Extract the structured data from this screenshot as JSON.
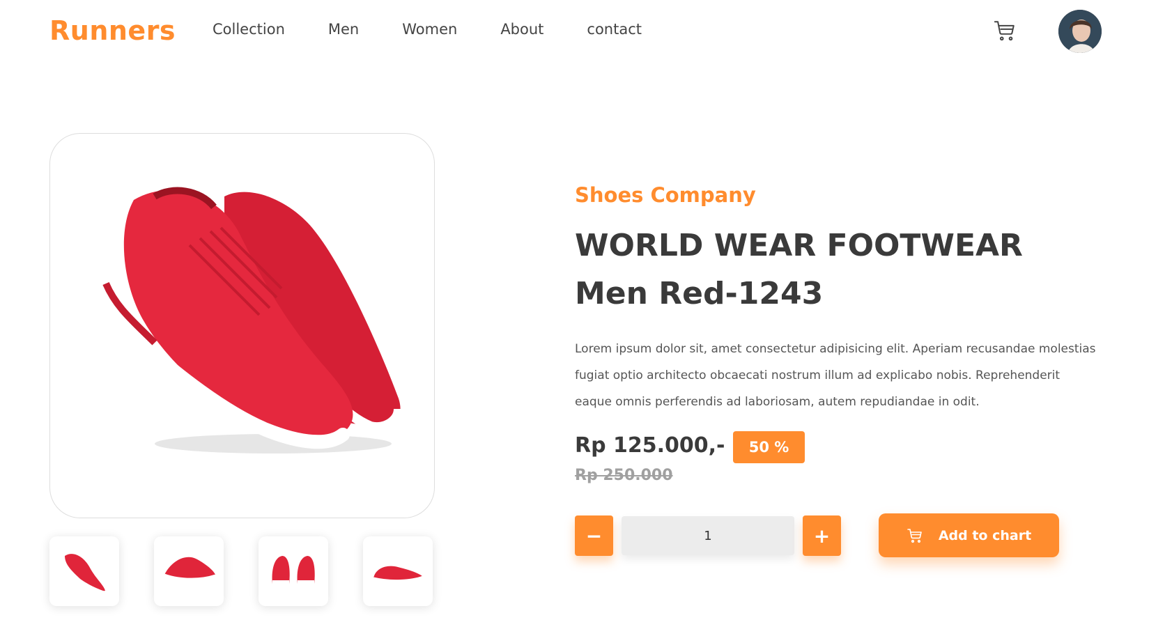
{
  "header": {
    "logo": "Runners",
    "nav": [
      "Collection",
      "Men",
      "Women",
      "About",
      "contact"
    ],
    "cart_icon": "cart-icon",
    "avatar_icon": "user-avatar"
  },
  "product": {
    "company": "Shoes Company",
    "title": "WORLD WEAR FOOTWEAR Men Red-1243",
    "description": "Lorem ipsum dolor sit, amet consectetur adipisicing elit. Aperiam recusandae molestias fugiat optio architecto obcaecati nostrum illum ad explicabo nobis. Reprehenderit eaque omnis perferendis ad laboriosam, autem repudiandae in odit.",
    "price": "Rp 125.000,-",
    "discount": "50 %",
    "old_price": "Rp 250.000",
    "quantity": "1",
    "minus_label": "−",
    "plus_label": "+",
    "add_label": "Add to chart"
  },
  "colors": {
    "accent": "#ff8c2e",
    "shoe_red": "#e0253a",
    "text_dark": "#3a3a3a"
  }
}
